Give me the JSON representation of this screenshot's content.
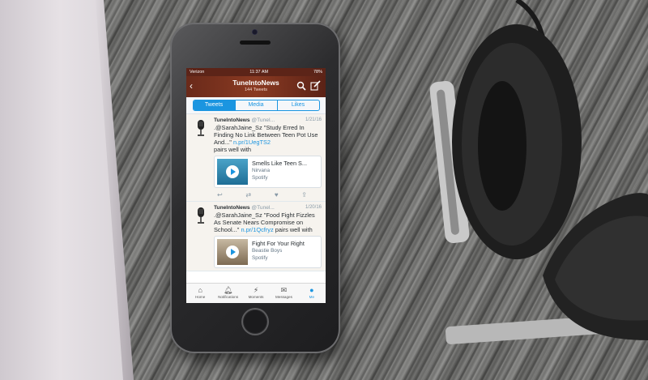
{
  "status_bar": {
    "carrier": "Verizon",
    "time": "11:37 AM",
    "battery": "78%"
  },
  "nav": {
    "title": "TuneIntoNews",
    "subtitle": "144 Tweets",
    "back_icon": "chevron-left-icon",
    "search_icon": "search-icon",
    "compose_icon": "compose-icon"
  },
  "tabs_segment": [
    {
      "label": "Tweets"
    },
    {
      "label": "Media"
    },
    {
      "label": "Likes"
    }
  ],
  "tweets": [
    {
      "name": "TuneIntoNews",
      "handle": "@TuneI...",
      "date": "1/21/16",
      "text": ".@SarahJaine_Sz \"Study Erred In Finding No Link Between Teen Pot Use And...\" ",
      "link": "n.pr/1UegTS2",
      "suffix": "pairs well with",
      "card": {
        "title": "Smells Like Teen S...",
        "artist": "Nirvana",
        "source": "Spotify"
      }
    },
    {
      "name": "TuneIntoNews",
      "handle": "@Tunel...",
      "date": "1/20/16",
      "text": ".@SarahJaine_Sz \"Food Fight Fizzles As Senate Nears Compromise on School...\" ",
      "link": "n.pr/1Qcfryz",
      "suffix": " pairs well with",
      "card": {
        "title": "Fight For Your Right",
        "artist": "Beastie Boys",
        "source": "Spotify"
      }
    }
  ],
  "tabbar": [
    {
      "label": "Home",
      "icon": "home-icon"
    },
    {
      "label": "Notifications",
      "icon": "bell-icon"
    },
    {
      "label": "Moments",
      "icon": "lightning-icon"
    },
    {
      "label": "Messages",
      "icon": "envelope-icon"
    },
    {
      "label": "Me",
      "icon": "person-icon"
    }
  ]
}
